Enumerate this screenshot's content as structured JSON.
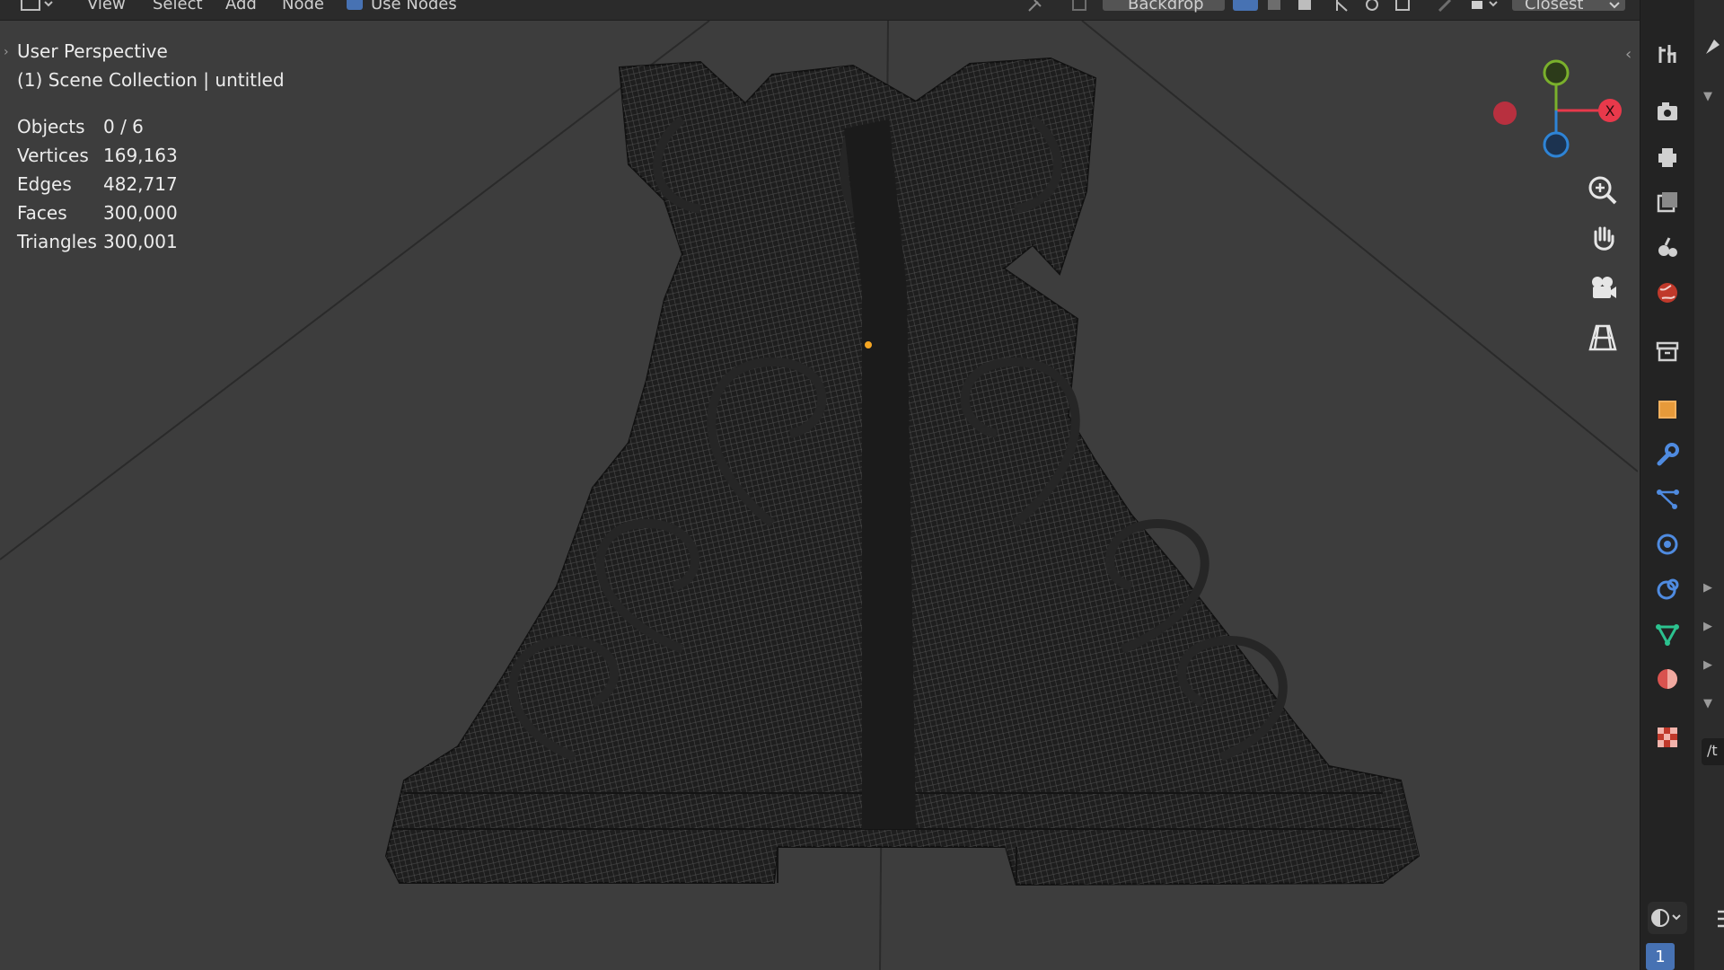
{
  "topbar": {
    "menu": [
      "View",
      "Select",
      "Add",
      "Node"
    ],
    "use_nodes_label": "Use Nodes",
    "use_nodes_checked": true,
    "backdrop_label": "Backdrop",
    "snap_target_label": "Closest"
  },
  "viewport": {
    "view_name": "User Perspective",
    "collection_line": "(1) Scene Collection | untitled",
    "stats": [
      {
        "label": "Objects",
        "value": "0 / 6"
      },
      {
        "label": "Vertices",
        "value": "169,163"
      },
      {
        "label": "Edges",
        "value": "482,717"
      },
      {
        "label": "Faces",
        "value": "300,000"
      },
      {
        "label": "Triangles",
        "value": "300,001"
      }
    ],
    "gizmo": {
      "x_label": "X",
      "x_color": "#e8394b",
      "y_color": "#7ab02c",
      "z_color": "#2e84d6"
    },
    "nav_icons": [
      "zoom-icon",
      "hand-pan-icon",
      "camera-icon",
      "ortho-grid-icon"
    ]
  },
  "properties_tabs": [
    "tool-icon",
    "render-icon",
    "output-icon",
    "view-layer-icon",
    "scene-icon",
    "world-icon",
    "collection-icon",
    "object-icon",
    "modifier-icon",
    "particles-icon",
    "physics-icon",
    "constraints-icon",
    "data-icon",
    "material-icon",
    "texture-icon"
  ],
  "bottom": {
    "frame_badge": "1"
  },
  "right_edge_letters": [
    "/t"
  ],
  "colors": {
    "accent": "#4772b3",
    "origin_dot": "#f5a623",
    "background": "#3d3d3d"
  }
}
